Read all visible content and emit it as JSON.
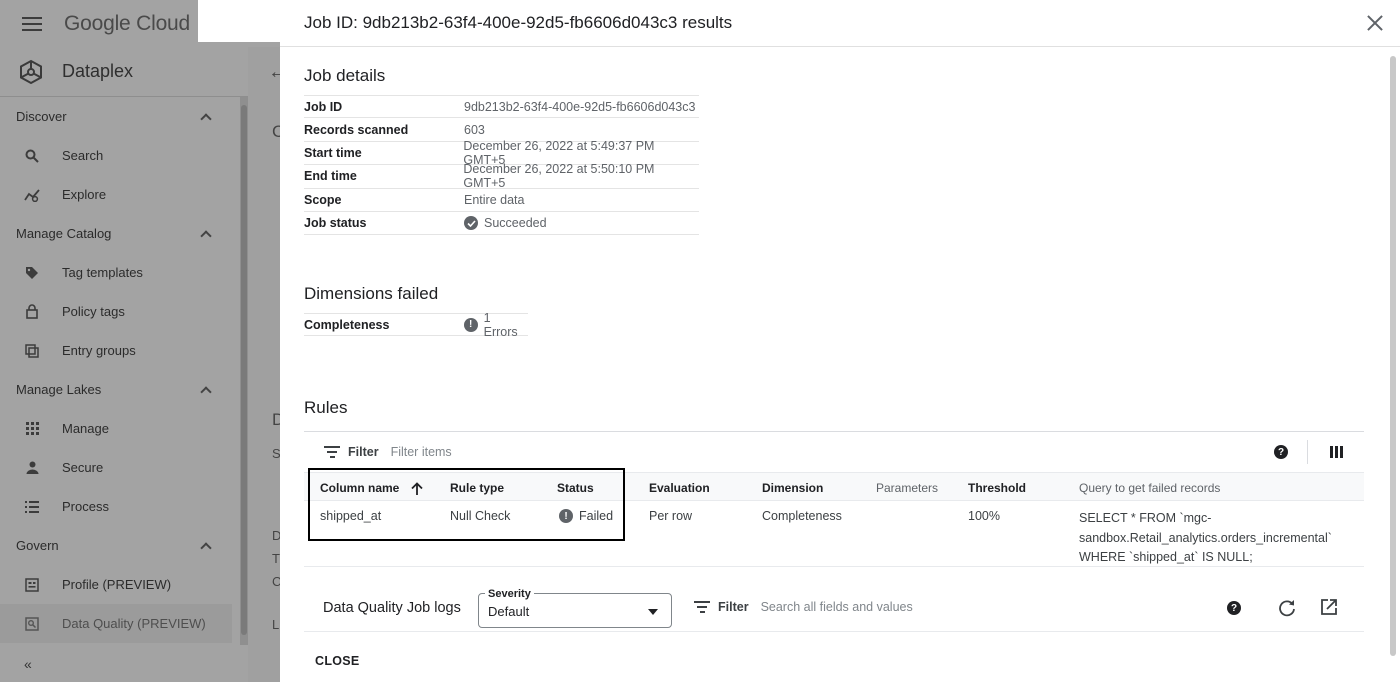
{
  "console": {
    "logo_text": "Google Cloud",
    "product_name": "Dataplex",
    "collapse_icon": "«"
  },
  "sidebar": {
    "sections": [
      {
        "title": "Discover",
        "items": [
          {
            "label": "Search",
            "icon": "search-icon"
          },
          {
            "label": "Explore",
            "icon": "explore-icon"
          }
        ]
      },
      {
        "title": "Manage Catalog",
        "items": [
          {
            "label": "Tag templates",
            "icon": "tag-icon"
          },
          {
            "label": "Policy tags",
            "icon": "lock-icon"
          },
          {
            "label": "Entry groups",
            "icon": "entry-groups-icon"
          }
        ]
      },
      {
        "title": "Manage Lakes",
        "items": [
          {
            "label": "Manage",
            "icon": "grid-icon"
          },
          {
            "label": "Secure",
            "icon": "person-icon"
          },
          {
            "label": "Process",
            "icon": "list-icon"
          }
        ]
      },
      {
        "title": "Govern",
        "items": [
          {
            "label": "Profile (PREVIEW)",
            "icon": "profile-icon"
          },
          {
            "label": "Data Quality (PREVIEW)",
            "icon": "data-quality-icon"
          }
        ]
      }
    ]
  },
  "behind_fragments": [
    "C",
    "D",
    "S",
    "D",
    "T",
    "C",
    "L"
  ],
  "dialog": {
    "title": "Job ID: 9db213b2-63f4-400e-92d5-fb6606d043c3 results",
    "job_details": {
      "heading": "Job details",
      "rows": [
        {
          "key": "Job ID",
          "value": "9db213b2-63f4-400e-92d5-fb6606d043c3"
        },
        {
          "key": "Records scanned",
          "value": "603"
        },
        {
          "key": "Start time",
          "value": "December 26, 2022 at 5:49:37 PM GMT+5"
        },
        {
          "key": "End time",
          "value": "December 26, 2022 at 5:50:10 PM GMT+5"
        },
        {
          "key": "Scope",
          "value": "Entire data"
        },
        {
          "key": "Job status",
          "value": "Succeeded"
        }
      ]
    },
    "dimensions_failed": {
      "heading": "Dimensions failed",
      "rows": [
        {
          "key": "Completeness",
          "value": "1 Errors"
        }
      ]
    },
    "rules": {
      "heading": "Rules",
      "filter_label": "Filter",
      "filter_placeholder": "Filter items",
      "columns": [
        "Column name",
        "Rule type",
        "Status",
        "Evaluation",
        "Dimension",
        "Parameters",
        "Threshold",
        "Query to get failed records"
      ],
      "rows": [
        {
          "column_name": "shipped_at",
          "rule_type": "Null Check",
          "status": "Failed",
          "evaluation": "Per row",
          "dimension": "Completeness",
          "parameters": "",
          "threshold": "100%",
          "query_lines": [
            "SELECT * FROM `mgc-",
            "sandbox.Retail_analytics.orders_incremental`",
            "WHERE `shipped_at` IS NULL;"
          ]
        }
      ]
    },
    "logs": {
      "title": "Data Quality Job logs",
      "severity_label": "Severity",
      "severity_value": "Default",
      "filter_label": "Filter",
      "filter_placeholder": "Search all fields and values"
    },
    "close_label": "CLOSE"
  }
}
